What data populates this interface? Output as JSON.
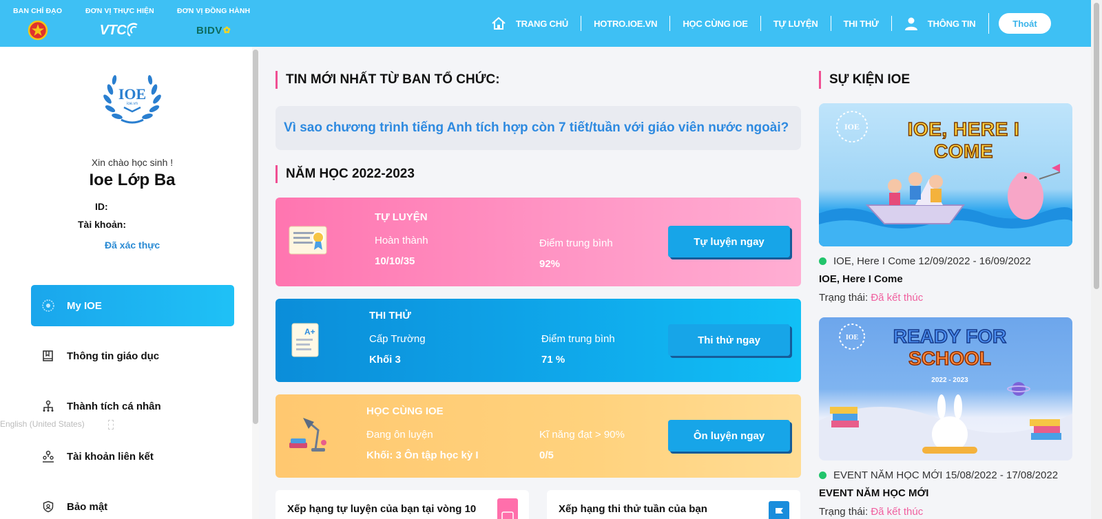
{
  "header": {
    "sponsors": [
      {
        "caption": "BAN CHỈ ĐẠO"
      },
      {
        "caption": "ĐƠN VỊ THỰC HIỆN",
        "logo_text": "VTC"
      },
      {
        "caption": "ĐƠN VỊ ĐỒNG HÀNH",
        "logo_text": "BIDV"
      }
    ],
    "nav": [
      {
        "label": "TRANG CHỦ",
        "icon": "home-icon"
      },
      {
        "label": "HOTRO.IOE.VN"
      },
      {
        "label": "HỌC CÙNG IOE"
      },
      {
        "label": "TỰ LUYỆN"
      },
      {
        "label": "THI THỬ"
      },
      {
        "label": "THÔNG TIN",
        "icon": "user-icon"
      }
    ],
    "logout_label": "Thoát"
  },
  "sidebar": {
    "logo_text": "IOE",
    "logo_sub": "ioe.vn",
    "greeting": "Xin chào học sinh !",
    "user_name": "Ioe Lớp Ba",
    "id_label": "ID:",
    "account_label": "Tài khoản:",
    "verified": "Đã xác thực",
    "menu": [
      {
        "label": "My IOE",
        "icon": "laurel-icon",
        "active": true
      },
      {
        "label": "Thông tin giáo dục",
        "icon": "book-icon"
      },
      {
        "label": "Thành tích cá nhân",
        "icon": "hierarchy-icon"
      },
      {
        "label": "Tài khoản liên kết",
        "icon": "link-users-icon"
      },
      {
        "label": "Bảo mật",
        "icon": "shield-icon"
      }
    ],
    "language_hint": "English (United States)"
  },
  "main": {
    "news_title": "TIN MỚI NHẤT TỪ BAN TỔ CHỨC:",
    "news_headline": "Vì sao chương trình tiếng Anh tích hợp còn 7 tiết/tuần với giáo viên nước ngoài?",
    "year_title": "NĂM HỌC 2022-2023",
    "cards": [
      {
        "title": "TỰ LUYỆN",
        "left_label": "Hoàn thành",
        "left_value": "10/10/35",
        "right_label": "Điểm trung bình",
        "right_value": "92%",
        "button": "Tự luyện ngay",
        "icon": "certificate-icon"
      },
      {
        "title": "THI THỬ",
        "left_label": "Cấp Trường",
        "left_value": "Khối 3",
        "right_label": "Điểm trung bình",
        "right_value": "71 %",
        "button": "Thi thử ngay",
        "icon": "test-paper-icon"
      },
      {
        "title": "HỌC CÙNG IOE",
        "left_label": "Đang ôn luyện",
        "left_value": "Khối: 3 Ôn tập học kỳ I",
        "right_label": "Kĩ năng đạt > 90%",
        "right_value": "0/5",
        "button": "Ôn luyện ngay",
        "icon": "desk-lamp-icon"
      }
    ],
    "rank_self_practice": "Xếp hạng tự luyện của bạn tại vòng 10",
    "rank_weekly_test": "Xếp hạng thi thử tuần của bạn"
  },
  "events": {
    "title": "SỰ KIỆN IOE",
    "items": [
      {
        "banner_text": "IOE, HERE I COME",
        "meta": "IOE, Here I Come 12/09/2022 - 16/09/2022",
        "name": "IOE, Here I Come",
        "status_label": "Trạng thái:",
        "status": "Đã kết thúc"
      },
      {
        "banner_text_1": "READY FOR",
        "banner_text_2": "SCHOOL",
        "banner_year": "2022 - 2023",
        "meta": "EVENT NĂM HỌC MỚI 15/08/2022 - 17/08/2022",
        "name": "EVENT NĂM HỌC MỚI",
        "status_label": "Trạng thái:",
        "status": "Đã kết thúc"
      }
    ]
  },
  "colors": {
    "header": "#3ec0f4",
    "accent_pink": "#f04f93",
    "link_blue": "#2e8ae0",
    "card_pink": "#ff75b0",
    "card_blue": "#0b8dd9",
    "card_orange": "#ffc870",
    "status_pink": "#f0609f",
    "dot_green": "#21c46b"
  }
}
